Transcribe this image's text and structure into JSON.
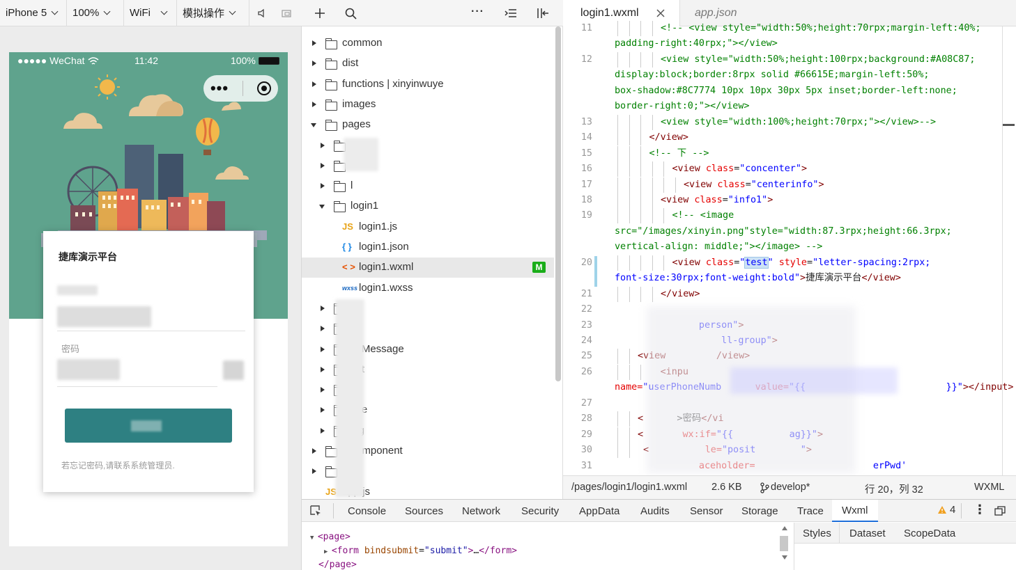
{
  "simulator": {
    "device": "iPhone 5",
    "zoom": "100%",
    "network": "WiFi",
    "operation": "模拟操作",
    "phone": {
      "carrier": "●●●●● WeChat",
      "time": "11:42",
      "battery": "100%",
      "login_title": "捷库演示平台",
      "password_label": "密码",
      "forgot_hint": "若忘记密码,请联系系统管理员."
    }
  },
  "explorer": {
    "items": [
      {
        "label": "common",
        "type": "folder",
        "depth": 0,
        "state": "collapsed"
      },
      {
        "label": "dist",
        "type": "folder",
        "depth": 0,
        "state": "collapsed"
      },
      {
        "label": "functions | xinyinwuye",
        "type": "cloud-folder",
        "depth": 0,
        "state": "collapsed"
      },
      {
        "label": "images",
        "type": "folder",
        "depth": 0,
        "state": "collapsed"
      },
      {
        "label": "pages",
        "type": "folder",
        "depth": 0,
        "state": "expanded"
      },
      {
        "label": "",
        "type": "folder",
        "depth": 1,
        "state": "collapsed"
      },
      {
        "label": "",
        "type": "folder",
        "depth": 1,
        "state": "collapsed"
      },
      {
        "label": "l",
        "type": "folder",
        "depth": 1,
        "state": "collapsed"
      },
      {
        "label": "login1",
        "type": "folder",
        "depth": 1,
        "state": "expanded"
      },
      {
        "label": "login1.js",
        "type": "js",
        "depth": 2
      },
      {
        "label": "login1.json",
        "type": "json",
        "depth": 2
      },
      {
        "label": "login1.wxml",
        "type": "wxml",
        "depth": 2,
        "badge": "M"
      },
      {
        "label": "login1.wxss",
        "type": "wxss",
        "depth": 2
      },
      {
        "label": "s",
        "type": "folder",
        "depth": 1,
        "state": "collapsed"
      },
      {
        "label": "",
        "type": "folder",
        "depth": 1,
        "state": "collapsed"
      },
      {
        "label": "ceMessage",
        "type": "folder",
        "depth": 1,
        "state": "collapsed"
      },
      {
        "label": "ect",
        "type": "folder",
        "depth": 1,
        "state": "collapsed"
      },
      {
        "label": "rt",
        "type": "folder",
        "depth": 1,
        "state": "collapsed"
      },
      {
        "label": "late",
        "type": "folder",
        "depth": 1,
        "state": "collapsed"
      },
      {
        "label": "ing",
        "type": "folder",
        "depth": 1,
        "state": "collapsed"
      },
      {
        "label": "tal      omponent",
        "type": "folder",
        "depth": 0,
        "state": "collapsed"
      },
      {
        "label": "",
        "type": "folder",
        "depth": 0,
        "state": "collapsed"
      },
      {
        "label": "app.js",
        "type": "js",
        "depth": 0
      }
    ],
    "file_icon_labels": {
      "js": "JS",
      "json": "{ }",
      "wxml": "< >",
      "wxss": "wxss"
    }
  },
  "editor": {
    "tabs": [
      {
        "label": "login1.wxml",
        "active": true
      },
      {
        "label": "app.json",
        "active": false
      }
    ],
    "lines": [
      {
        "n": "11",
        "cont": false,
        "indent": 4,
        "segs": [
          [
            "com",
            "<!-- <view style=\"width:50%;height:70rpx;margin-left:40%;"
          ]
        ]
      },
      {
        "n": "",
        "cont": true,
        "indent": 0,
        "segs": [
          [
            "com",
            "padding-right:40rpx;\"></view>"
          ]
        ]
      },
      {
        "n": "12",
        "cont": false,
        "indent": 4,
        "segs": [
          [
            "com",
            "<view style=\"width:50%;height:100rpx;background:#A08C87;"
          ]
        ]
      },
      {
        "n": "",
        "cont": true,
        "indent": 0,
        "segs": [
          [
            "com",
            "display:block;border:8rpx solid #66615E;margin-left:50%;"
          ]
        ]
      },
      {
        "n": "",
        "cont": true,
        "indent": 0,
        "segs": [
          [
            "com",
            "box-shadow:#8C7774 10px 10px 30px 5px inset;border-left:none;"
          ]
        ]
      },
      {
        "n": "",
        "cont": true,
        "indent": 0,
        "segs": [
          [
            "com",
            "border-right:0;\"></view>"
          ]
        ]
      },
      {
        "n": "13",
        "cont": false,
        "indent": 4,
        "segs": [
          [
            "com",
            "<view style=\"width:100%;height:70rpx;\"></view>-->"
          ]
        ]
      },
      {
        "n": "14",
        "cont": false,
        "indent": 3,
        "segs": [
          [
            "tag",
            "</view>"
          ]
        ]
      },
      {
        "n": "15",
        "cont": false,
        "indent": 3,
        "segs": [
          [
            "com",
            "<!-- 下 -->"
          ]
        ]
      },
      {
        "n": "16",
        "cont": false,
        "indent": 5,
        "segs": [
          [
            "tag",
            "<view "
          ],
          [
            "attr",
            "class"
          ],
          [
            "txt",
            "="
          ],
          [
            "val",
            "\"concenter\""
          ],
          [
            "tag",
            ">"
          ]
        ]
      },
      {
        "n": "17",
        "cont": false,
        "indent": 6,
        "segs": [
          [
            "tag",
            "<view "
          ],
          [
            "attr",
            "class"
          ],
          [
            "txt",
            "="
          ],
          [
            "val",
            "\"centerinfo\""
          ],
          [
            "tag",
            ">"
          ]
        ]
      },
      {
        "n": "18",
        "cont": false,
        "indent": 4,
        "segs": [
          [
            "tag",
            "<view "
          ],
          [
            "attr",
            "class"
          ],
          [
            "txt",
            "="
          ],
          [
            "val",
            "\"info1\""
          ],
          [
            "tag",
            ">"
          ]
        ]
      },
      {
        "n": "19",
        "cont": false,
        "indent": 5,
        "segs": [
          [
            "com",
            "<!-- <image"
          ]
        ]
      },
      {
        "n": "",
        "cont": true,
        "indent": 0,
        "segs": [
          [
            "com",
            "src=\"/images/xinyin.png\"style=\"width:87.3rpx;height:66.3rpx;"
          ]
        ]
      },
      {
        "n": "",
        "cont": true,
        "indent": 0,
        "segs": [
          [
            "com",
            "vertical-align: middle;\"></image> -->"
          ]
        ]
      },
      {
        "n": "20",
        "cont": false,
        "indent": 5,
        "segs": [
          [
            "tag",
            "<view "
          ],
          [
            "attr",
            "class"
          ],
          [
            "txt",
            "="
          ],
          [
            "val",
            "\""
          ],
          [
            "val",
            "test"
          ],
          [
            "val",
            "\""
          ],
          [
            "txt",
            " "
          ],
          [
            "attr",
            "style"
          ],
          [
            "txt",
            "="
          ],
          [
            "val",
            "\"letter-spacing:2rpx;"
          ]
        ]
      },
      {
        "n": "",
        "cont": true,
        "indent": 0,
        "segs": [
          [
            "val",
            "font-size:30rpx;font-weight:bold\""
          ],
          [
            "tag",
            ">"
          ],
          [
            "txt",
            "捷库演示平台"
          ],
          [
            "tag",
            "</view>"
          ]
        ]
      },
      {
        "n": "21",
        "cont": false,
        "indent": 4,
        "segs": [
          [
            "tag",
            "</view>"
          ]
        ]
      },
      {
        "n": "22",
        "cont": false,
        "indent": 0,
        "segs": []
      },
      {
        "n": "23",
        "cont": false,
        "indent": 0,
        "segs": [
          [
            "val",
            "               person\""
          ],
          [
            "tag",
            ">"
          ]
        ]
      },
      {
        "n": "24",
        "cont": false,
        "indent": 0,
        "segs": [
          [
            "val",
            "                   ll-group\""
          ],
          [
            "tag",
            ">"
          ]
        ]
      },
      {
        "n": "25",
        "cont": false,
        "indent": 2,
        "segs": [
          [
            "tag",
            "<view "
          ],
          [
            "tag",
            "        /view>"
          ]
        ]
      },
      {
        "n": "26",
        "cont": false,
        "indent": 3,
        "segs": [
          [
            "tag",
            "  <inpu"
          ]
        ]
      },
      {
        "n": "",
        "cont": true,
        "indent": 0,
        "segs": [
          [
            "attr",
            "name="
          ],
          [
            "val",
            "\"userPhoneNumb"
          ],
          [
            "txt",
            "      "
          ],
          [
            "attr",
            "value="
          ],
          [
            "val",
            "\"{{                         }}\""
          ],
          [
            "tag",
            "></input>"
          ]
        ]
      },
      {
        "n": "27",
        "cont": false,
        "indent": 0,
        "segs": []
      },
      {
        "n": "28",
        "cont": false,
        "indent": 2,
        "segs": [
          [
            "tag",
            "<"
          ],
          [
            "txt",
            "      >密码"
          ],
          [
            "tag",
            "</vi"
          ]
        ]
      },
      {
        "n": "29",
        "cont": false,
        "indent": 2,
        "segs": [
          [
            "tag",
            "<"
          ],
          [
            "attr",
            "       wx:if="
          ],
          [
            "val",
            "\"{{          ag}}\""
          ],
          [
            "tag",
            ">"
          ]
        ]
      },
      {
        "n": "30",
        "cont": false,
        "indent": 2,
        "segs": [
          [
            "tag",
            " <"
          ],
          [
            "attr",
            "          le="
          ],
          [
            "val",
            "\"posit        \""
          ],
          [
            "tag",
            ">"
          ]
        ]
      },
      {
        "n": "31",
        "cont": false,
        "indent": 0,
        "segs": [
          [
            "attr",
            "               aceholder="
          ],
          [
            "val",
            "                     erPwd'"
          ]
        ]
      }
    ],
    "status": {
      "path": "/pages/login1/login1.wxml",
      "size": "2.6 KB",
      "branch": "develop*",
      "position": "行 20，列 32",
      "language": "WXML"
    }
  },
  "devtools": {
    "tabs": [
      "Console",
      "Sources",
      "Network",
      "Security",
      "AppData",
      "Audits",
      "Sensor",
      "Storage",
      "Trace",
      "Wxml"
    ],
    "active_tab": "Wxml",
    "warnings": "4",
    "wxml_tree": [
      {
        "indent": 0,
        "arrow": "▼",
        "segs": [
          [
            "tag",
            "<page>"
          ]
        ]
      },
      {
        "indent": 1,
        "arrow": "▶",
        "segs": [
          [
            "tag",
            "<form "
          ],
          [
            "attr",
            "bindsubmit"
          ],
          [
            "txt",
            "="
          ],
          [
            "val",
            "\"submit\""
          ],
          [
            "tag",
            ">"
          ],
          [
            "txt",
            "…"
          ],
          [
            "tag",
            "</form>"
          ]
        ]
      },
      {
        "indent": 0,
        "arrow": "",
        "segs": [
          [
            "tag",
            "</page>"
          ]
        ]
      }
    ],
    "side_tabs": [
      "Styles",
      "Dataset",
      "ScopeData"
    ]
  },
  "colors": {
    "hero_green": "#5fa38d",
    "login_button": "#2e8082",
    "badge_green": "#1aad19",
    "active_tab_border": "#1e6fd9"
  }
}
